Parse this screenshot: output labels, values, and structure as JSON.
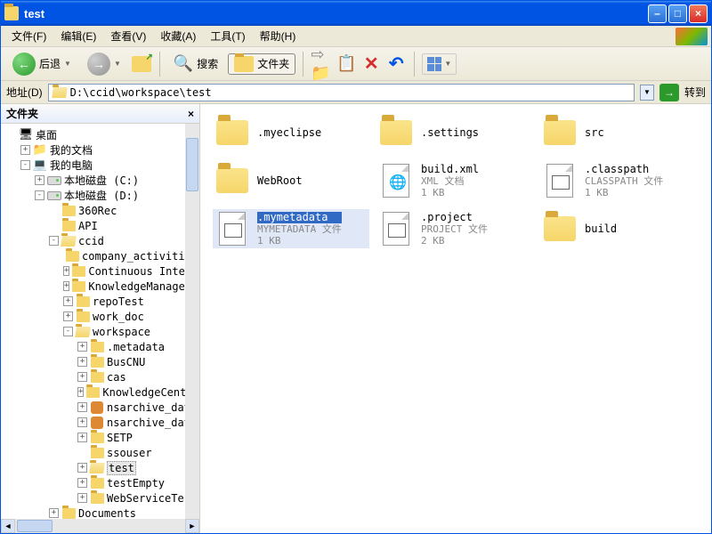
{
  "titlebar": {
    "title": "test"
  },
  "menu": {
    "file": "文件(F)",
    "edit": "编辑(E)",
    "view": "查看(V)",
    "favorites": "收藏(A)",
    "tools": "工具(T)",
    "help": "帮助(H)"
  },
  "toolbar": {
    "back": "后退",
    "search": "搜索",
    "folders": "文件夹"
  },
  "address": {
    "label": "地址(D)",
    "path": "D:\\ccid\\workspace\\test",
    "go": "转到"
  },
  "sidebar": {
    "title": "文件夹",
    "tree": [
      {
        "depth": 0,
        "exp": "",
        "icon": "desktop",
        "label": "桌面"
      },
      {
        "depth": 1,
        "exp": "+",
        "icon": "mydocs",
        "label": "我的文档"
      },
      {
        "depth": 1,
        "exp": "-",
        "icon": "mycomputer",
        "label": "我的电脑"
      },
      {
        "depth": 2,
        "exp": "+",
        "icon": "drive",
        "label": "本地磁盘 (C:)"
      },
      {
        "depth": 2,
        "exp": "-",
        "icon": "drive",
        "label": "本地磁盘 (D:)"
      },
      {
        "depth": 3,
        "exp": "",
        "icon": "folder",
        "label": "360Rec"
      },
      {
        "depth": 3,
        "exp": "",
        "icon": "folder",
        "label": "API"
      },
      {
        "depth": 3,
        "exp": "-",
        "icon": "folder-open",
        "label": "ccid"
      },
      {
        "depth": 4,
        "exp": "",
        "icon": "folder",
        "label": "company_activities"
      },
      {
        "depth": 4,
        "exp": "+",
        "icon": "folder",
        "label": "Continuous Integra"
      },
      {
        "depth": 4,
        "exp": "+",
        "icon": "folder",
        "label": "KnowledgeManageSys"
      },
      {
        "depth": 4,
        "exp": "+",
        "icon": "folder",
        "label": "repoTest"
      },
      {
        "depth": 4,
        "exp": "+",
        "icon": "folder",
        "label": "work_doc"
      },
      {
        "depth": 4,
        "exp": "-",
        "icon": "folder-open",
        "label": "workspace"
      },
      {
        "depth": 5,
        "exp": "+",
        "icon": "folder",
        "label": ".metadata"
      },
      {
        "depth": 5,
        "exp": "+",
        "icon": "folder",
        "label": "BusCNU"
      },
      {
        "depth": 5,
        "exp": "+",
        "icon": "folder",
        "label": "cas"
      },
      {
        "depth": 5,
        "exp": "+",
        "icon": "folder",
        "label": "KnowledgeCenter"
      },
      {
        "depth": 5,
        "exp": "+",
        "icon": "special",
        "label": "nsarchive_data"
      },
      {
        "depth": 5,
        "exp": "+",
        "icon": "special",
        "label": "nsarchive_data"
      },
      {
        "depth": 5,
        "exp": "+",
        "icon": "folder",
        "label": "SETP"
      },
      {
        "depth": 5,
        "exp": "",
        "icon": "folder",
        "label": "ssouser"
      },
      {
        "depth": 5,
        "exp": "+",
        "icon": "folder-open",
        "label": "test",
        "selected": true
      },
      {
        "depth": 5,
        "exp": "+",
        "icon": "folder",
        "label": "testEmpty"
      },
      {
        "depth": 5,
        "exp": "+",
        "icon": "folder",
        "label": "WebServiceTest"
      },
      {
        "depth": 3,
        "exp": "+",
        "icon": "folder",
        "label": "Documents"
      }
    ]
  },
  "content": {
    "items": [
      {
        "type": "folder",
        "name": ".myeclipse"
      },
      {
        "type": "folder",
        "name": ".settings"
      },
      {
        "type": "folder",
        "name": "src"
      },
      {
        "type": "folder",
        "name": "WebRoot"
      },
      {
        "type": "file",
        "icon": "xml",
        "name": "build.xml",
        "meta1": "XML 文档",
        "meta2": "1 KB"
      },
      {
        "type": "file",
        "icon": "grid",
        "name": ".classpath",
        "meta1": "CLASSPATH 文件",
        "meta2": "1 KB"
      },
      {
        "type": "file",
        "icon": "grid",
        "name": ".mymetadata",
        "meta1": "MYMETADATA 文件",
        "meta2": "1 KB",
        "selected": true
      },
      {
        "type": "file",
        "icon": "grid",
        "name": ".project",
        "meta1": "PROJECT 文件",
        "meta2": "2 KB"
      },
      {
        "type": "folder",
        "name": "build"
      }
    ]
  }
}
